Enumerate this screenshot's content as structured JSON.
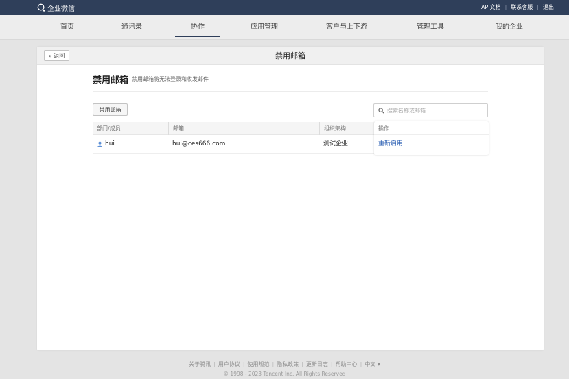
{
  "topbar": {
    "logo_text": "企业微信",
    "links": [
      "API文档",
      "联系客服",
      "退出"
    ]
  },
  "nav": {
    "items": [
      "首页",
      "通讯录",
      "协作",
      "应用管理",
      "客户与上下游",
      "管理工具",
      "我的企业"
    ],
    "active_index": 2
  },
  "panel": {
    "back_label": "« 返回",
    "title": "禁用邮箱",
    "section_title": "禁用邮箱",
    "section_desc": "禁用邮箱将无法登录和收发邮件",
    "disable_button": "禁用邮箱",
    "search_placeholder": "搜索名称或邮箱"
  },
  "table": {
    "headers": [
      "部门/成员",
      "邮箱",
      "组织架构",
      "操作"
    ],
    "rows": [
      {
        "member": "hui",
        "email": "hui@ces666.com",
        "org": "测试企业",
        "action": "重新启用"
      }
    ]
  },
  "footer": {
    "links": [
      "关于腾讯",
      "用户协议",
      "使用规范",
      "隐私政策",
      "更新日志",
      "帮助中心",
      "中文 ▾"
    ],
    "copyright": "© 1998 - 2023 Tencent Inc. All Rights Reserved"
  },
  "colors": {
    "topbar": "#2f3f5a",
    "link": "#2b5fb3",
    "user_icon": "#5b8fd6"
  }
}
